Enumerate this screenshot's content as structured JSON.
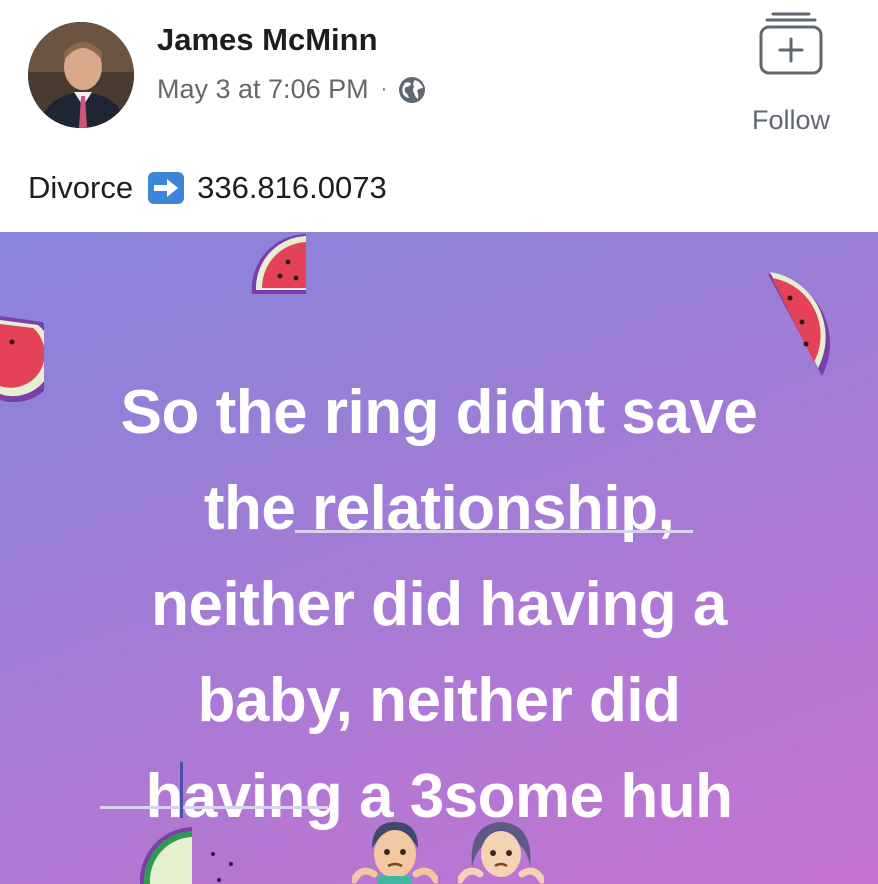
{
  "post": {
    "author_name": "James McMinn",
    "timestamp": "May 3 at 7:06 PM",
    "separator": "·",
    "follow_label": "Follow",
    "caption_word": "Divorce",
    "caption_phone": "336.816.0073",
    "icons": {
      "avatar": "profile-photo",
      "privacy": "globe-icon",
      "follow": "add-to-stack-icon",
      "arrow": "right-arrow-emoji"
    }
  },
  "background_post": {
    "lines": [
      "So the ring didnt save",
      "the relationship,",
      "neither did having a",
      "baby, neither did",
      "having a 3some huh"
    ],
    "colors": {
      "gradient_start": "#8a84dc",
      "gradient_end": "#c473d2",
      "text": "#ffffff"
    },
    "decorations": [
      "watermelon-slice",
      "watermelon-slice",
      "watermelon-slice",
      "watermelon-slice",
      "shrugging-man-emoji",
      "shrugging-woman-emoji"
    ]
  }
}
